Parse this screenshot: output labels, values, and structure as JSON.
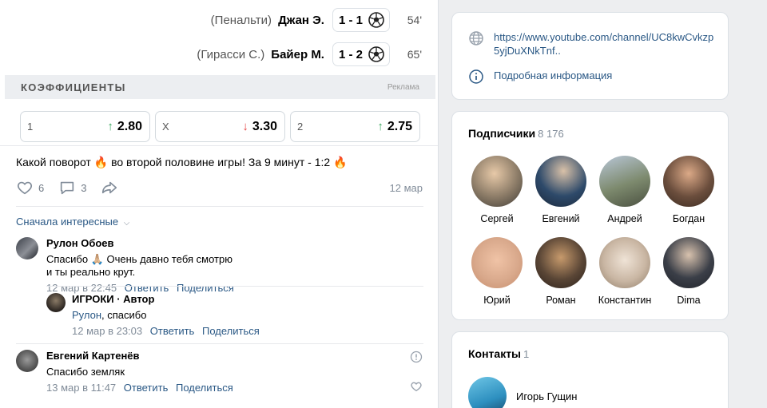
{
  "match": {
    "goals": [
      {
        "note": "(Пенальти)",
        "scorer": "Джан Э.",
        "score": "1 - 1",
        "minute": "54'",
        "icon": "ball-icon"
      },
      {
        "note": "(Гирасси С.)",
        "scorer": "Байер М.",
        "score": "1 - 2",
        "minute": "65'",
        "icon": "ball-icon"
      }
    ]
  },
  "odds": {
    "title": "КОЭФФИЦИЕНТЫ",
    "ad_label": "Реклама",
    "items": [
      {
        "label": "1",
        "value": "2.80",
        "trend": "up"
      },
      {
        "label": "X",
        "value": "3.30",
        "trend": "down"
      },
      {
        "label": "2",
        "value": "2.75",
        "trend": "up"
      }
    ],
    "arrow_up": "↑",
    "arrow_down": "↓"
  },
  "post": {
    "text_part1": "Какой поворот",
    "text_part2": "во второй половине игры! За 9 минут - 1:2",
    "emoji": "🔥",
    "likes": "6",
    "comments": "3",
    "date": "12 мар",
    "colors": {
      "accent": "#2a5885",
      "up": "#3ca760",
      "down": "#e64646"
    }
  },
  "comments": {
    "sort_label": "Сначала интересные",
    "items": [
      {
        "name": "Рулон Обоев",
        "text": "Спасибо 🙏🏼 Очень давно тебя смотрю и ты реально крут.",
        "date": "12 мар в 22:45",
        "reply": "Ответить",
        "share": "Поделиться"
      },
      {
        "name": "ИГРОКИ · Автор",
        "mention": "Рулон",
        "text": ", спасибо",
        "date": "12 мар в 23:03",
        "reply": "Ответить",
        "share": "Поделиться"
      },
      {
        "name": "Евгений Картенёв",
        "text": "Спасибо земляк",
        "date": "13 мар в 11:47",
        "reply": "Ответить",
        "share": "Поделиться"
      }
    ]
  },
  "info": {
    "link": "https://www.youtube.com/channel/UC8kwCvkzp5yjDuXNkTnf..",
    "details": "Подробная информация"
  },
  "subscribers": {
    "title": "Подписчики",
    "count": "8 176",
    "items": [
      {
        "name": "Сергей",
        "color": "#8a7a66"
      },
      {
        "name": "Евгений",
        "color": "#2e4a6a"
      },
      {
        "name": "Андрей",
        "color": "#7d8a6e"
      },
      {
        "name": "Богдан",
        "color": "#6b4e3d"
      },
      {
        "name": "Юрий",
        "color": "#d9a98c"
      },
      {
        "name": "Роман",
        "color": "#5a4636"
      },
      {
        "name": "Константин",
        "color": "#c9b6a3"
      },
      {
        "name": "Dima",
        "color": "#3b3f48"
      }
    ]
  },
  "contacts": {
    "title": "Контакты",
    "count": "1",
    "items": [
      {
        "name": "Игорь Гущин"
      }
    ]
  }
}
